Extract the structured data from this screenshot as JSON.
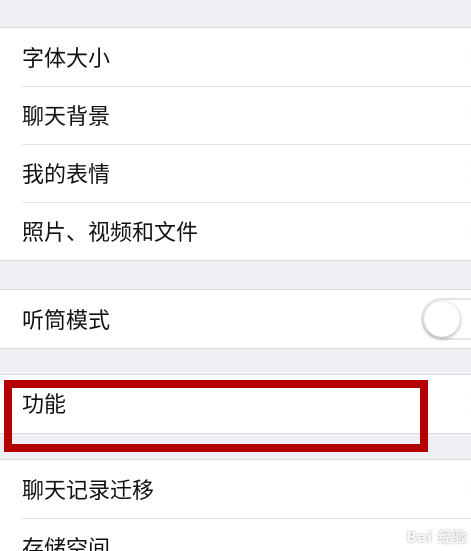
{
  "display_group": {
    "items": [
      {
        "label": "字体大小"
      },
      {
        "label": "聊天背景"
      },
      {
        "label": "我的表情"
      },
      {
        "label": "照片、视频和文件"
      }
    ]
  },
  "earpiece_group": {
    "label": "听筒模式",
    "toggle_state": "off"
  },
  "features_group": {
    "label": "功能"
  },
  "storage_group": {
    "items": [
      {
        "label": "聊天记录迁移"
      },
      {
        "label": "存储空间"
      }
    ]
  },
  "annotation": {
    "color": "#b30000"
  },
  "watermark": {
    "text": "Bai 经验"
  }
}
